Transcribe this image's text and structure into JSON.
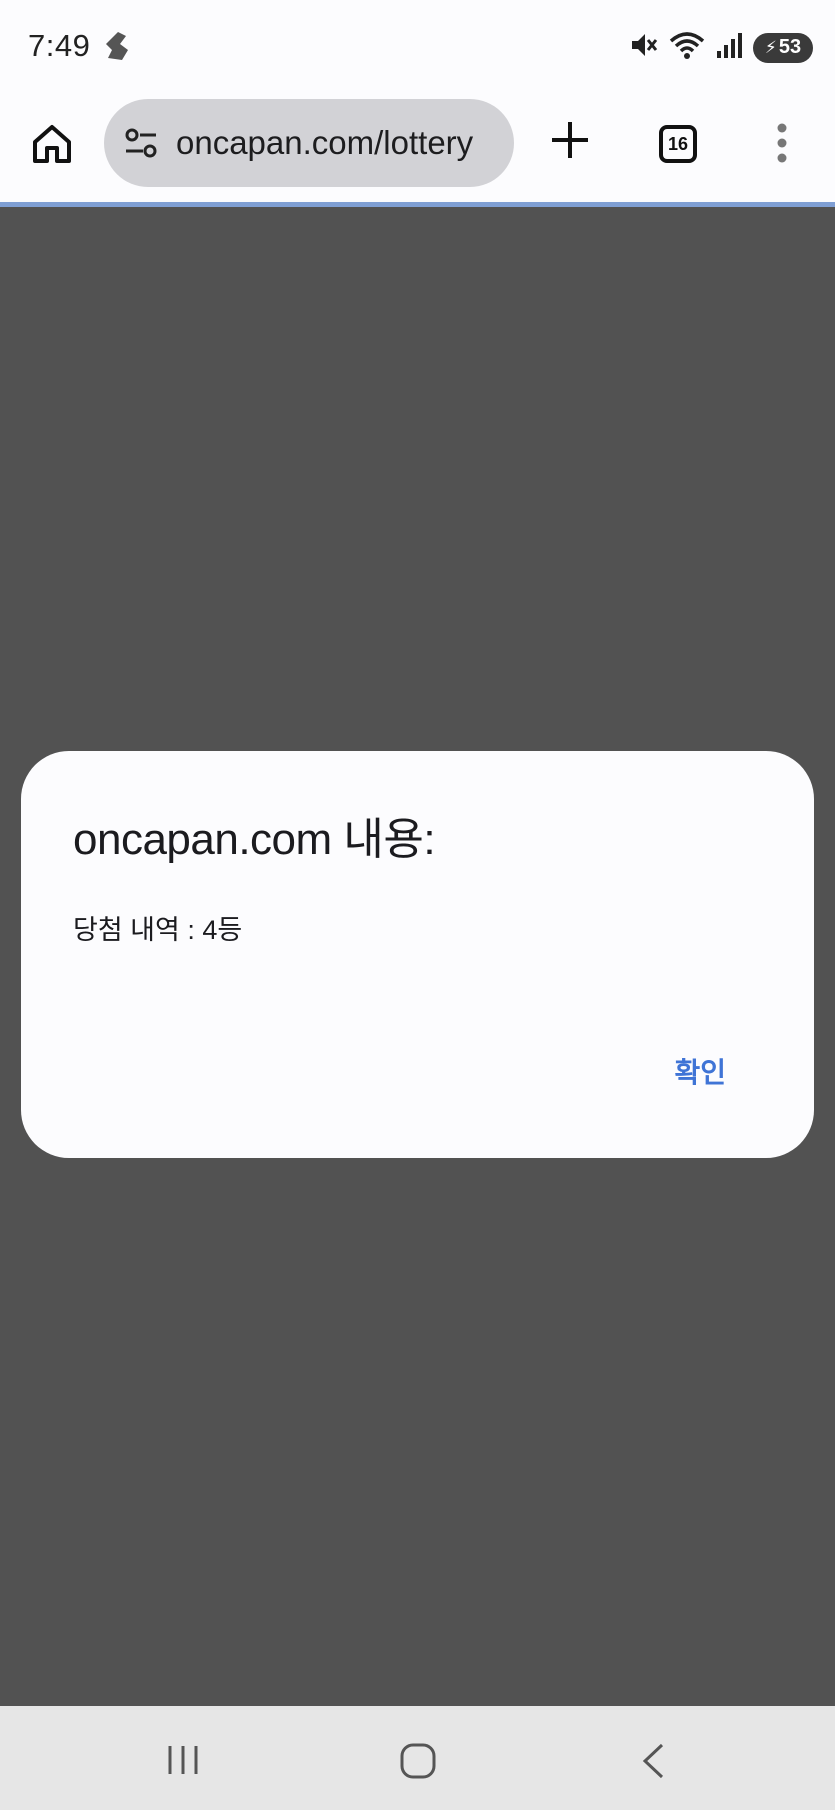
{
  "status_bar": {
    "time": "7:49",
    "battery_level": "53",
    "icons": [
      "running-app-icon",
      "mute-icon",
      "wifi-icon",
      "signal-icon",
      "battery-charging-icon"
    ]
  },
  "browser": {
    "url": "oncapan.com/lottery",
    "tab_count": "16"
  },
  "dialog": {
    "title": "oncapan.com 내용:",
    "message": "당첨 내역 : 4등",
    "confirm_label": "확인"
  },
  "colors": {
    "accent": "#3f74d6",
    "overlay": "#525252",
    "progress_line": "#7f9fd4"
  }
}
